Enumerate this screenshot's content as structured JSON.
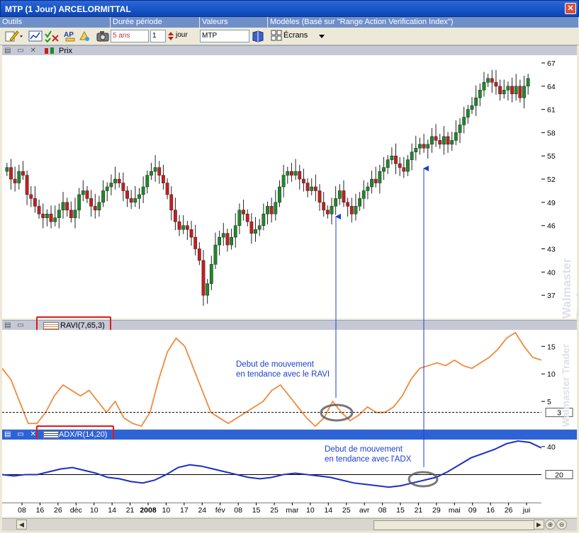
{
  "window": {
    "title": "MTP (1 Jour) ARCELORMITTAL",
    "close_glyph": "✕"
  },
  "toolbar": {
    "section_tools": "Outils",
    "section_period": "Durée  période",
    "section_values": "Valeurs",
    "section_models": "Modèles (Basé sur \"Range Action Verification Index\")",
    "period_value": "5 ans",
    "period_count": "1",
    "period_unit": "jour",
    "symbol": "MTP",
    "screens_label": "Écrans"
  },
  "panels": {
    "price_label": "Prix",
    "ravi_label": "RAVI(7,65,3)",
    "adx_label": "ADX/R(14,20)"
  },
  "price_axis": [
    67,
    64,
    61,
    58,
    55,
    52,
    49,
    46,
    43,
    40,
    37
  ],
  "ravi_axis": [
    15,
    10,
    5
  ],
  "ravi_threshold": "3",
  "adx_axis": [
    40
  ],
  "adx_threshold": "20",
  "watermark": "Walmaster Trader",
  "annotations": {
    "ravi": [
      "Debut de mouvement",
      "en tendance avec le RAVI"
    ],
    "adx": [
      "Debut de mouvement",
      "en tendance avec l'ADX"
    ]
  },
  "x_axis": {
    "labels": [
      "08",
      "16",
      "26",
      "déc",
      "10",
      "14",
      "21",
      "2008",
      "10",
      "17",
      "24",
      "fév",
      "08",
      "15",
      "25",
      "mar",
      "10",
      "14",
      "25",
      "avr",
      "08",
      "15",
      "21",
      "29",
      "mai",
      "09",
      "16",
      "26",
      "jui"
    ]
  },
  "chart_data": [
    {
      "type": "candlestick",
      "name": "Prix",
      "ylim": [
        34,
        68
      ],
      "close": [
        53.5,
        52,
        51.5,
        53,
        52.5,
        50,
        49.5,
        48.5,
        47.5,
        47,
        47.5,
        46.5,
        47,
        48,
        49,
        48,
        47,
        48,
        50,
        50.5,
        49.5,
        48.5,
        48,
        49,
        50.5,
        51,
        51.5,
        52,
        51.5,
        50.5,
        49.5,
        49,
        49.5,
        50,
        51,
        52.5,
        53,
        53.5,
        52.5,
        51.5,
        50,
        48,
        46.5,
        45.5,
        46,
        45.5,
        44.5,
        43,
        41.5,
        37,
        38.5,
        41,
        43.5,
        44.5,
        45,
        43.5,
        44.5,
        46,
        48,
        47.5,
        46.5,
        45,
        45.5,
        46,
        47.5,
        48.5,
        47.5,
        49,
        51,
        52.5,
        53,
        52.5,
        53,
        52,
        51.5,
        50.5,
        51,
        50.5,
        49,
        48,
        47.5,
        48.5,
        49.5,
        50.5,
        49,
        48.5,
        47.5,
        48.5,
        49.5,
        50.5,
        51,
        52,
        51.5,
        53,
        53.5,
        54.5,
        55,
        54,
        53.5,
        53,
        54.5,
        55.5,
        56,
        56.5,
        56,
        56.5,
        57.5,
        57,
        56.5,
        57.5,
        56.5,
        57,
        58,
        59,
        60,
        61,
        61.5,
        62.5,
        63.5,
        64.5,
        65,
        64.5,
        64,
        63,
        63.5,
        64,
        63,
        64,
        62.5,
        64,
        65
      ]
    },
    {
      "type": "line",
      "name": "RAVI",
      "ylim": [
        0,
        18
      ],
      "threshold": 3,
      "y": [
        11,
        9,
        5,
        1,
        1,
        3,
        6,
        8,
        7,
        6,
        7,
        5,
        3,
        5,
        2,
        1,
        0.5,
        3,
        9,
        14,
        16.5,
        15,
        11,
        7,
        3,
        2,
        1,
        2,
        3,
        4,
        5,
        7,
        8,
        6,
        4,
        2,
        0.5,
        2,
        5,
        3,
        1.5,
        2.5,
        4,
        3,
        3,
        4,
        6,
        9,
        11,
        11.5,
        12,
        11.5,
        12.5,
        11.5,
        11,
        12,
        13,
        14.5,
        16.5,
        17.5,
        15,
        13,
        12.5
      ]
    },
    {
      "type": "line",
      "name": "ADX",
      "ylim": [
        0,
        45
      ],
      "threshold": 20,
      "y": [
        20,
        19,
        20,
        20,
        22,
        24,
        25,
        23,
        21,
        18,
        17,
        15,
        14,
        16,
        20,
        25,
        27,
        26,
        24,
        22,
        20,
        18,
        17,
        18,
        20,
        21,
        20,
        19,
        18,
        16,
        14,
        13,
        12,
        11,
        12,
        14,
        16,
        18,
        22,
        27,
        32,
        35,
        38,
        42,
        44,
        43,
        39
      ]
    }
  ]
}
